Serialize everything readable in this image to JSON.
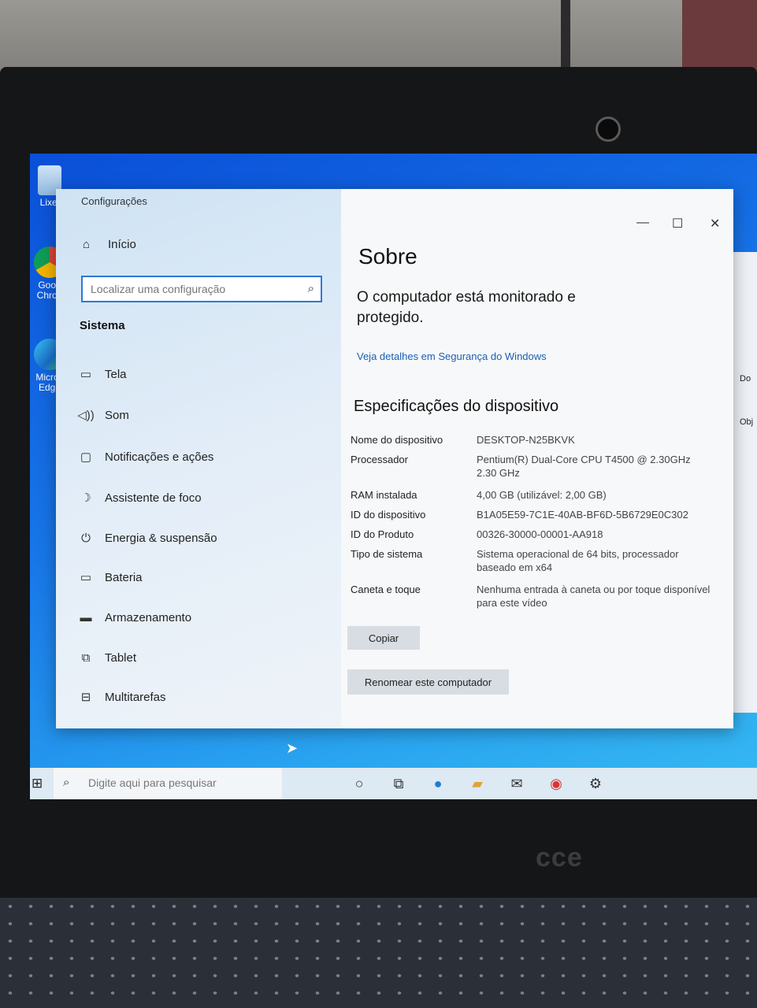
{
  "desktop": {
    "icons": [
      {
        "label": "Lixei",
        "icon": "recycle-bin-icon"
      },
      {
        "label": "Goog Chron",
        "icon": "chrome-icon"
      },
      {
        "label": "Micros Edge",
        "icon": "edge-icon"
      }
    ]
  },
  "window": {
    "title": "Configurações",
    "controls": {
      "minimize": "—",
      "maximize": "☐",
      "close": "✕"
    }
  },
  "sidebar": {
    "home_label": "Início",
    "search_placeholder": "Localizar uma configuração",
    "section": "Sistema",
    "items": [
      {
        "label": "Tela",
        "icon": "monitor-icon"
      },
      {
        "label": "Som",
        "icon": "speaker-icon"
      },
      {
        "label": "Notificações e ações",
        "icon": "notification-icon"
      },
      {
        "label": "Assistente de foco",
        "icon": "moon-icon"
      },
      {
        "label": "Energia & suspensão",
        "icon": "power-icon"
      },
      {
        "label": "Bateria",
        "icon": "battery-icon"
      },
      {
        "label": "Armazenamento",
        "icon": "storage-icon"
      },
      {
        "label": "Tablet",
        "icon": "tablet-icon"
      },
      {
        "label": "Multitarefas",
        "icon": "multitask-icon"
      }
    ]
  },
  "about": {
    "title": "Sobre",
    "protection_text": "O computador está monitorado e protegido.",
    "security_link": "Veja detalhes em Segurança do Windows",
    "spec_title": "Especificações do dispositivo",
    "specs": [
      {
        "key": "Nome do dispositivo",
        "value": "DESKTOP-N25BKVK"
      },
      {
        "key": "Processador",
        "value": "Pentium(R) Dual-Core CPU      T4500  @ 2.30GHz   2.30 GHz"
      },
      {
        "key": "RAM instalada",
        "value": "4,00 GB (utilizável: 2,00 GB)"
      },
      {
        "key": "ID do dispositivo",
        "value": "B1A05E59-7C1E-40AB-BF6D-5B6729E0C302"
      },
      {
        "key": "ID do Produto",
        "value": "00326-30000-00001-AA918"
      },
      {
        "key": "Tipo de sistema",
        "value": "Sistema operacional de 64 bits, processador baseado em x64"
      },
      {
        "key": "Caneta e toque",
        "value": "Nenhuma entrada à caneta ou por toque disponível para este vídeo"
      }
    ],
    "copy_button": "Copiar",
    "rename_button": "Renomear este computador"
  },
  "background_window": {
    "labels": [
      "Do",
      "Obj"
    ]
  },
  "taskbar": {
    "search_placeholder": "Digite aqui para pesquisar"
  },
  "hardware": {
    "brand": "cce"
  }
}
